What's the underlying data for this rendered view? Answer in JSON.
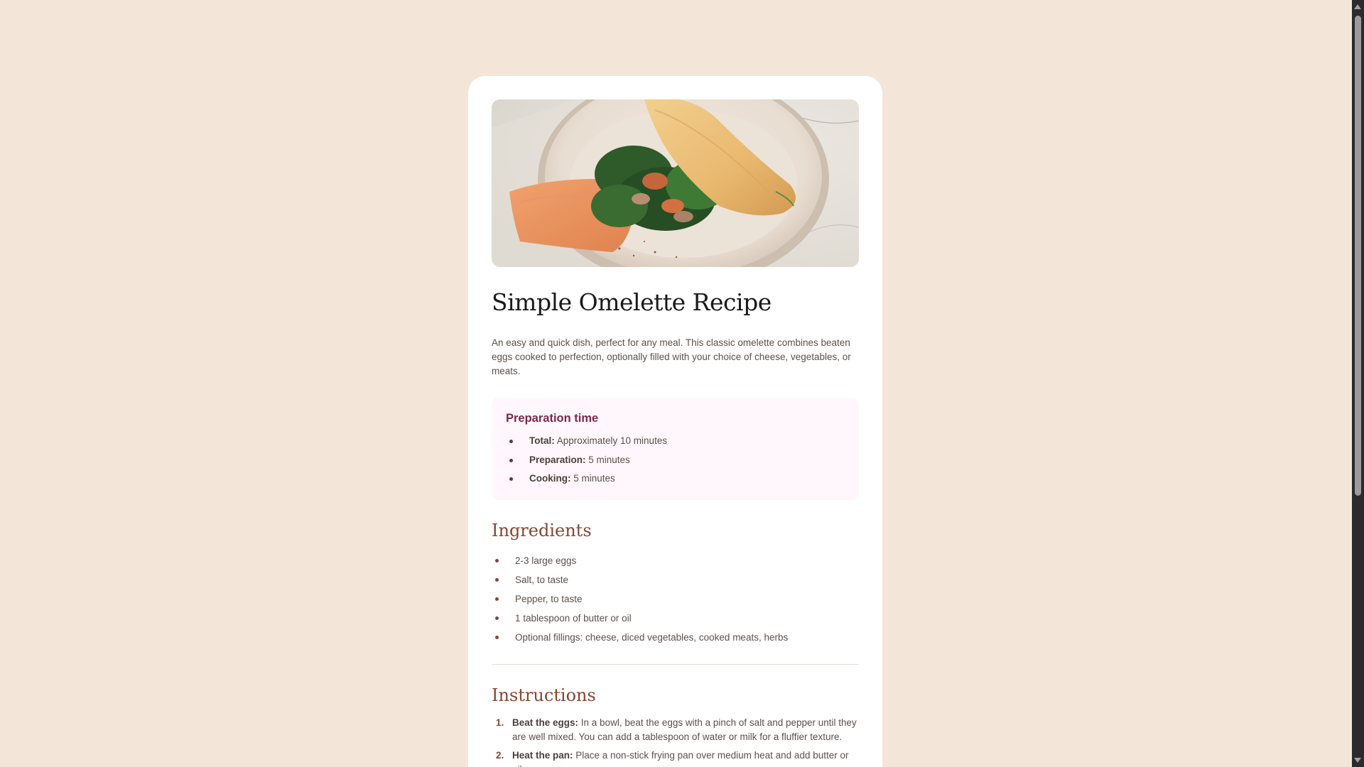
{
  "recipe": {
    "title": "Simple Omelette Recipe",
    "intro": "An easy and quick dish, perfect for any meal. This classic omelette combines beaten eggs cooked to perfection, optionally filled with your choice of cheese, vegetables, or meats.",
    "image_icon": "omelette-photo"
  },
  "preparation": {
    "title": "Preparation time",
    "items": [
      {
        "label": "Total:",
        "value": " Approximately 10 minutes"
      },
      {
        "label": "Preparation:",
        "value": " 5 minutes"
      },
      {
        "label": "Cooking:",
        "value": " 5 minutes"
      }
    ]
  },
  "ingredients": {
    "title": "Ingredients",
    "items": [
      "2-3 large eggs",
      "Salt, to taste",
      "Pepper, to taste",
      "1 tablespoon of butter or oil",
      "Optional fillings: cheese, diced vegetables, cooked meats, herbs"
    ]
  },
  "instructions": {
    "title": "Instructions",
    "items": [
      {
        "num": "1.",
        "label": "Beat the eggs:",
        "value": " In a bowl, beat the eggs with a pinch of salt and pepper until they are well mixed. You can add a tablespoon of water or milk for a fluffier texture."
      },
      {
        "num": "2.",
        "label": "Heat the pan:",
        "value": " Place a non-stick frying pan over medium heat and add butter or oil."
      }
    ]
  },
  "colors": {
    "background": "#f3e5d8",
    "card": "#ffffff",
    "accent_brown": "#854632",
    "accent_plum": "#7a284b",
    "prep_background": "#fff7fb"
  }
}
